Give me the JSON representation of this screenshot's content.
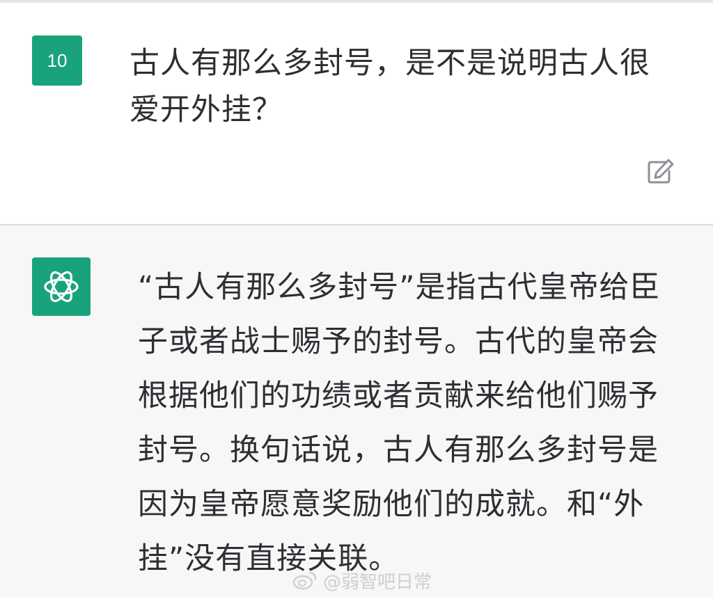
{
  "user_message": {
    "avatar_label": "10",
    "text": "古人有那么多封号，是不是说明古人很爱开外挂？"
  },
  "assistant_message": {
    "text": "“古人有那么多封号”是指古代皇帝给臣子或者战士赐予的封号。古代的皇帝会根据他们的功绩或者贡献来给他们赐予封号。换句话说，古人有那么多封号是因为皇帝愿意奖励他们的成就。和“外挂”没有直接关联。"
  },
  "watermark": {
    "text": "@弱智吧日常"
  },
  "icons": {
    "edit": "edit-icon",
    "assistant_logo": "openai-logo-icon",
    "weibo": "weibo-icon"
  },
  "colors": {
    "avatar_green": "#19a37d",
    "assistant_bg": "#f7f7f8",
    "text": "#2e2e33"
  }
}
